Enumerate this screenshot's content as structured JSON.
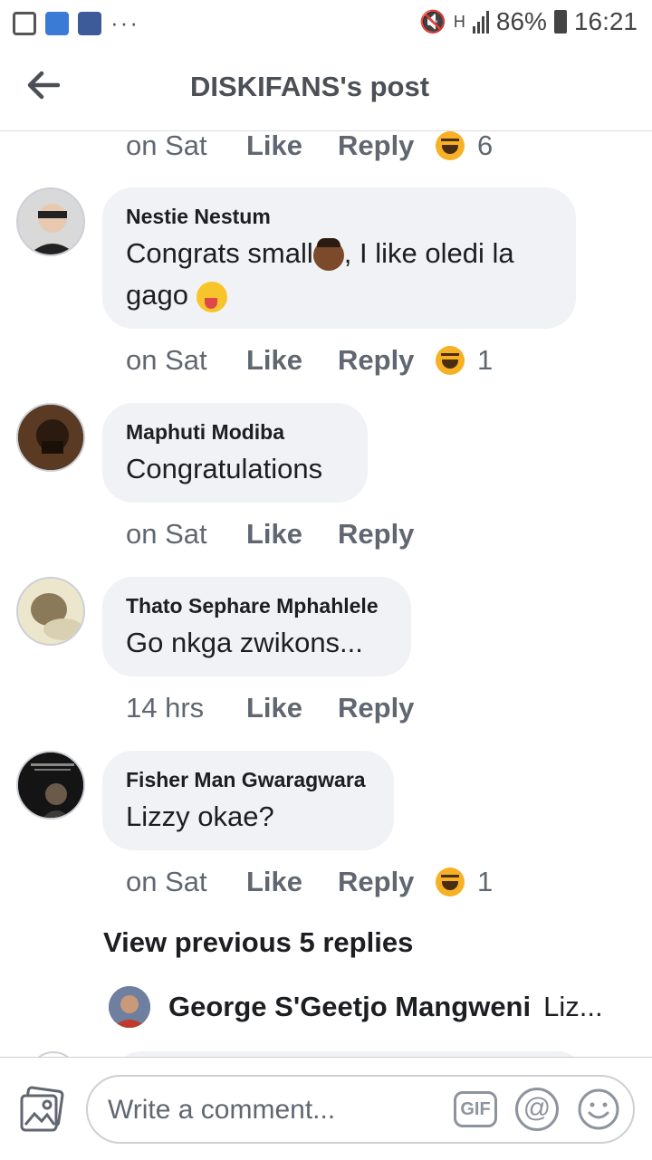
{
  "status_bar": {
    "battery": "86%",
    "time": "16:21",
    "network": "H",
    "dots": "···",
    "icons": [
      "gallery-icon",
      "rocket-app-icon",
      "n-app-icon",
      "mute-icon",
      "signal-icon",
      "battery-icon"
    ]
  },
  "header": {
    "title": "DISKIFANS's post",
    "back_icon": "arrow-left-icon"
  },
  "top_actions": {
    "time": "on Sat",
    "like": "Like",
    "reply": "Reply",
    "reaction_count": "6"
  },
  "comments": [
    {
      "author": "Nestie Nestum",
      "text_part1": "Congrats small",
      "text_part2": ", I like oledi la",
      "text_part3": "gago",
      "time": "on Sat",
      "like": "Like",
      "reply": "Reply",
      "reaction_count": "1"
    },
    {
      "author": "Maphuti Modiba",
      "text": "Congratulations",
      "time": "on Sat",
      "like": "Like",
      "reply": "Reply"
    },
    {
      "author": "Thato Sephare Mphahlele",
      "text": "Go nkga zwikons...",
      "time": "14 hrs",
      "like": "Like",
      "reply": "Reply"
    },
    {
      "author": "Fisher Man Gwaragwara",
      "text": "Lizzy okae?",
      "time": "on Sat",
      "like": "Like",
      "reply": "Reply",
      "reaction_count": "1"
    }
  ],
  "view_previous": "View previous 5 replies",
  "nested_reply": {
    "author": "George S'Geetjo Mangweni",
    "preview": "Liz..."
  },
  "composer": {
    "placeholder": "Write a comment...",
    "gif_label": "GIF",
    "at_label": "@"
  },
  "colors": {
    "bubble": "#f0f2f5",
    "reaction": "#f7b125",
    "text_secondary": "#606770"
  }
}
